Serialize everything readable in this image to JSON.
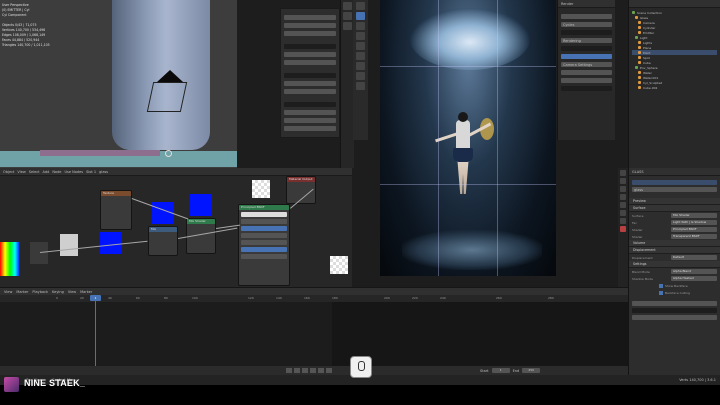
{
  "branding": {
    "channel_name": "NINE STAEK_"
  },
  "viewport": {
    "stats": [
      "Objects  0/43 | 71,075",
      "Vertices  140,700 / 534,496",
      "Edges  108,009 / 1,068,149",
      "Faces  44,884 / 520,944",
      "Triangles  140,700 / 1,011,105"
    ],
    "mode_title": "User Perspective",
    "collection": "(0) EMITTER | Cyl",
    "item_label": "Cyl Component"
  },
  "node_editor": {
    "header": {
      "menu": [
        "View",
        "Select",
        "Add",
        "Node"
      ],
      "mode": "Object",
      "use_nodes_label": "Use Nodes",
      "slot_label": "Slot 1",
      "material": "glass"
    },
    "nodes": [
      {
        "title": "Texture"
      },
      {
        "title": "Mix"
      },
      {
        "title": "Mix Shader"
      },
      {
        "title": "Principled BSDF"
      },
      {
        "title": "Material Output"
      }
    ]
  },
  "timeline": {
    "menu": [
      "View",
      "Marker",
      "Playback",
      "Keying",
      "View",
      "Marker"
    ],
    "current_frame": "1",
    "ticks": [
      "0",
      "20",
      "40",
      "60",
      "80",
      "100",
      "120",
      "140",
      "160",
      "180",
      "200",
      "220",
      "240",
      "260",
      "280"
    ],
    "start_label": "Start",
    "start_value": "1",
    "end_label": "End",
    "end_value": "250"
  },
  "statusbar": {
    "left": "Pick 1",
    "mid": "Pan View",
    "right": "Context Menu",
    "version": "Verts 140,700 | 3.6.1"
  },
  "outliner": {
    "items": [
      "Scene Collection",
      "Glass",
      "Camera",
      "Cylinder",
      "Emitter",
      "Light",
      "Lights",
      "Plane",
      "Point",
      "Spot",
      "Cube",
      "Env_Sphere",
      "Water",
      "Water.001",
      "Cyl_Sculpted",
      "Cube.002"
    ]
  },
  "properties": {
    "object_name": "GLASS",
    "material_name": "glass",
    "sections": [
      "Preview",
      "Surface",
      "Volume",
      "Displacement",
      "Settings"
    ],
    "rows": [
      {
        "label": "Surface",
        "value": "Mix Shader"
      },
      {
        "label": "Fac",
        "value": "Light Path | Is Shadow"
      },
      {
        "label": "Shader",
        "value": "Principled BSDF"
      },
      {
        "label": "Shader",
        "value": "Transparent BSDF"
      },
      {
        "label": "Displacement",
        "value": "Default"
      },
      {
        "label": "Blend Mode",
        "value": "Alpha Blend"
      },
      {
        "label": "Shadow Mode",
        "value": "Alpha Hashed"
      }
    ],
    "checks": [
      "Show Backface",
      "Backface Culling"
    ]
  },
  "render_panel": {
    "title": "Render",
    "rows": [
      "Cycles",
      "Rendering",
      "Camera Settings"
    ]
  },
  "colors": {
    "accent_blue": "#4772b3",
    "blue_swatch": "#0014ff",
    "floor_teal": "#6fa3a8"
  }
}
